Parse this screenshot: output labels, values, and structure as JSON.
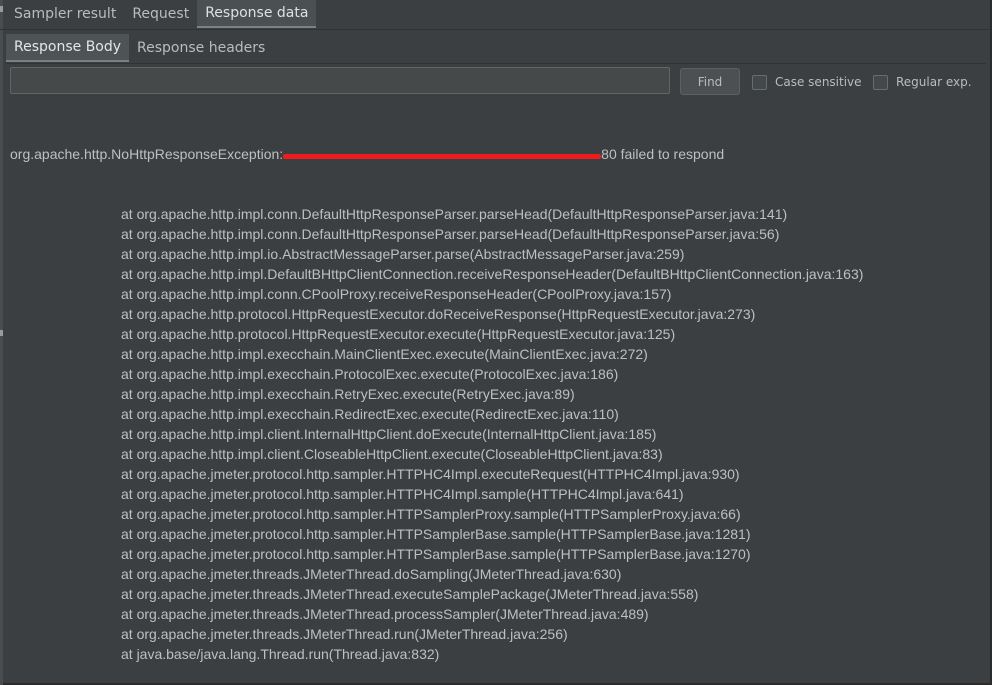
{
  "tabs": [
    {
      "label": "Sampler result",
      "active": false
    },
    {
      "label": "Request",
      "active": false
    },
    {
      "label": "Response data",
      "active": true
    }
  ],
  "subtabs": [
    {
      "label": "Response Body",
      "active": true
    },
    {
      "label": "Response headers",
      "active": false
    }
  ],
  "search": {
    "value": "",
    "placeholder": "",
    "find_label": "Find",
    "case_sensitive_label": "Case sensitive",
    "regular_exp_label": "Regular exp."
  },
  "response": {
    "exception_prefix": "org.apache.http.NoHttpResponseException:",
    "exception_suffix": "80 failed to respond",
    "stack": [
      "at org.apache.http.impl.conn.DefaultHttpResponseParser.parseHead(DefaultHttpResponseParser.java:141)",
      "at org.apache.http.impl.conn.DefaultHttpResponseParser.parseHead(DefaultHttpResponseParser.java:56)",
      "at org.apache.http.impl.io.AbstractMessageParser.parse(AbstractMessageParser.java:259)",
      "at org.apache.http.impl.DefaultBHttpClientConnection.receiveResponseHeader(DefaultBHttpClientConnection.java:163)",
      "at org.apache.http.impl.conn.CPoolProxy.receiveResponseHeader(CPoolProxy.java:157)",
      "at org.apache.http.protocol.HttpRequestExecutor.doReceiveResponse(HttpRequestExecutor.java:273)",
      "at org.apache.http.protocol.HttpRequestExecutor.execute(HttpRequestExecutor.java:125)",
      "at org.apache.http.impl.execchain.MainClientExec.execute(MainClientExec.java:272)",
      "at org.apache.http.impl.execchain.ProtocolExec.execute(ProtocolExec.java:186)",
      "at org.apache.http.impl.execchain.RetryExec.execute(RetryExec.java:89)",
      "at org.apache.http.impl.execchain.RedirectExec.execute(RedirectExec.java:110)",
      "at org.apache.http.impl.client.InternalHttpClient.doExecute(InternalHttpClient.java:185)",
      "at org.apache.http.impl.client.CloseableHttpClient.execute(CloseableHttpClient.java:83)",
      "at org.apache.jmeter.protocol.http.sampler.HTTPHC4Impl.executeRequest(HTTPHC4Impl.java:930)",
      "at org.apache.jmeter.protocol.http.sampler.HTTPHC4Impl.sample(HTTPHC4Impl.java:641)",
      "at org.apache.jmeter.protocol.http.sampler.HTTPSamplerProxy.sample(HTTPSamplerProxy.java:66)",
      "at org.apache.jmeter.protocol.http.sampler.HTTPSamplerBase.sample(HTTPSamplerBase.java:1281)",
      "at org.apache.jmeter.protocol.http.sampler.HTTPSamplerBase.sample(HTTPSamplerBase.java:1270)",
      "at org.apache.jmeter.threads.JMeterThread.doSampling(JMeterThread.java:630)",
      "at org.apache.jmeter.threads.JMeterThread.executeSamplePackage(JMeterThread.java:558)",
      "at org.apache.jmeter.threads.JMeterThread.processSampler(JMeterThread.java:489)",
      "at org.apache.jmeter.threads.JMeterThread.run(JMeterThread.java:256)",
      "at java.base/java.lang.Thread.run(Thread.java:832)"
    ]
  },
  "colors": {
    "background": "#3c3f41",
    "redaction": "#ee1c1c"
  }
}
